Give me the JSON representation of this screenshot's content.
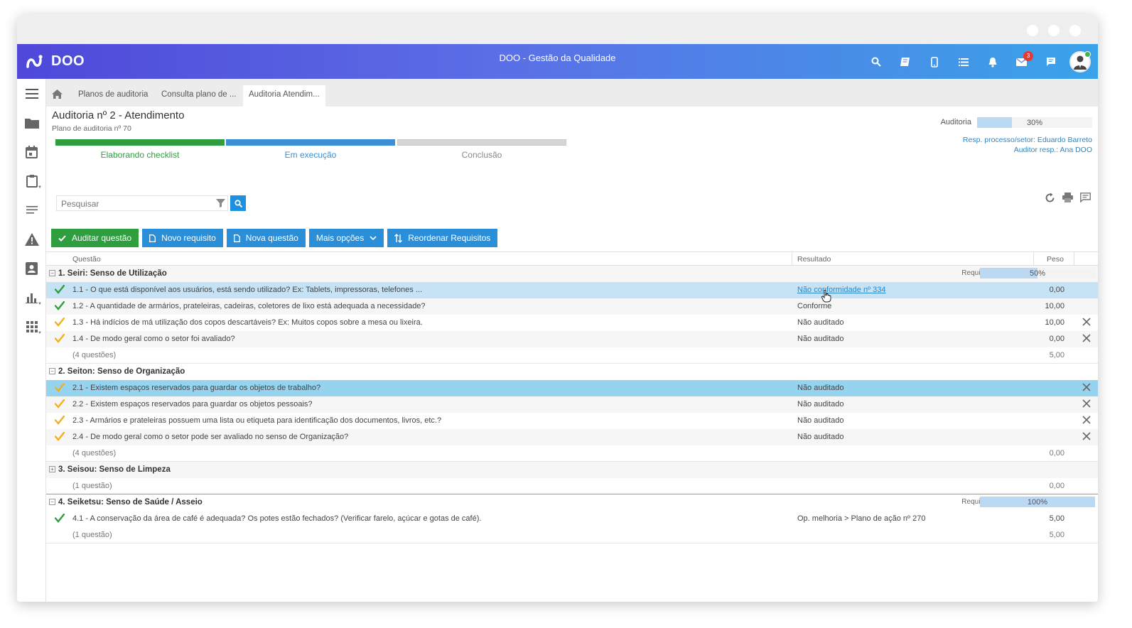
{
  "app": {
    "logo_text": "DOO",
    "title": "DOO - Gestão da Qualidade",
    "notification_count": "3"
  },
  "topbar_icons": [
    "search-icon",
    "book-icon",
    "mobile-icon",
    "list-icon",
    "bell-icon",
    "mail-icon",
    "chat-icon"
  ],
  "sidebar_icons": [
    "menu-icon",
    "folder-icon",
    "calendar-icon",
    "clipboard-icon",
    "lines-icon",
    "warning-icon",
    "contact-icon",
    "chart-icon",
    "apps-icon"
  ],
  "breadcrumb": {
    "tabs": [
      "Planos de auditoria",
      "Consulta plano de ...",
      "Auditoria Atendim..."
    ]
  },
  "header": {
    "title": "Auditoria nº 2 - Atendimento",
    "subtitle": "Plano de auditoria nº 70",
    "steps": [
      {
        "label": "Elaborando checklist",
        "color": "#2e9e3f",
        "text_color": "#2e9e3f"
      },
      {
        "label": "Em execução",
        "color": "#3b8fd4",
        "text_color": "#3b8fd4"
      },
      {
        "label": "Conclusão",
        "color": "#d6d6d6",
        "text_color": "#888888"
      }
    ],
    "audit_label": "Auditoria",
    "audit_progress": 0.3,
    "audit_progress_text": "30%",
    "resp_process": "Resp. processo/setor: Eduardo Barreto",
    "auditor": "Auditor resp.: Ana DOO"
  },
  "search": {
    "placeholder": "Pesquisar"
  },
  "toolbar": {
    "audit": "Auditar questão",
    "new_req": "Novo requisito",
    "new_question": "Nova questão",
    "more": "Mais opções",
    "reorder": "Reordenar Requisitos"
  },
  "grid": {
    "columns": {
      "question": "Questão",
      "result": "Resultado",
      "weight": "Peso"
    },
    "groups": [
      {
        "title": "1. Seiri: Senso de Utilização",
        "expanded": true,
        "req_label": "Requisito",
        "req_progress": 0.5,
        "req_text": "50%",
        "rows": [
          {
            "q": "1.1 - O que está disponível aos usuários, está sendo utilizado? Ex: Tablets, impressoras, telefones ...",
            "result": "Não conformidade nº 334",
            "weight": "0,00",
            "check": "green",
            "link": true,
            "x": false
          },
          {
            "q": "1.2 - A quantidade de armários, prateleiras, cadeiras, coletores de lixo está adequada a necessidade?",
            "result": "Conforme",
            "weight": "10,00",
            "check": "green",
            "link": false,
            "x": false
          },
          {
            "q": "1.3 - Há indícios de má utilização dos copos descartáveis? Ex: Muitos copos sobre a mesa ou lixeira.",
            "result": "Não auditado",
            "weight": "10,00",
            "check": "yellow",
            "link": false,
            "x": true
          },
          {
            "q": "1.4 - De modo geral como o setor foi avaliado?",
            "result": "Não auditado",
            "weight": "0,00",
            "check": "yellow",
            "link": false,
            "x": true
          }
        ],
        "summary": "(4 questões)",
        "summary_weight": "5,00"
      },
      {
        "title": "2. Seiton: Senso de Organização",
        "expanded": true,
        "rows": [
          {
            "q": "2.1 - Existem espaços reservados para guardar os objetos de trabalho?",
            "result": "Não auditado",
            "weight": "",
            "check": "yellow",
            "link": false,
            "x": true
          },
          {
            "q": "2.2 - Existem espaços reservados para guardar os objetos pessoais?",
            "result": "Não auditado",
            "weight": "",
            "check": "yellow",
            "link": false,
            "x": true
          },
          {
            "q": "2.3 - Armários e prateleiras possuem uma lista ou etiqueta para identificação dos documentos, livros, etc.?",
            "result": "Não auditado",
            "weight": "",
            "check": "yellow",
            "link": false,
            "x": true
          },
          {
            "q": "2.4 - De modo geral como o setor pode ser avaliado no senso de Organização?",
            "result": "Não auditado",
            "weight": "",
            "check": "yellow",
            "link": false,
            "x": true
          }
        ],
        "summary": "(4 questões)",
        "summary_weight": "0,00"
      },
      {
        "title": "3. Seisou: Senso de Limpeza",
        "expanded": false,
        "rows": [],
        "summary": "(1 questão)",
        "summary_weight": "0,00"
      },
      {
        "title": "4. Seiketsu: Senso de Saúde / Asseio",
        "expanded": true,
        "req_label": "Requisito",
        "req_progress": 1.0,
        "req_text": "100%",
        "rows": [
          {
            "q": "4.1 - A conservação da área de café é adequada? Os potes estão fechados? (Verificar farelo, açúcar e gotas de café).",
            "result": "Op. melhoria > Plano de ação nº 270",
            "weight": "5,00",
            "check": "green",
            "link": false,
            "x": false
          }
        ],
        "summary": "(1 questão)",
        "summary_weight": "5,00"
      }
    ]
  }
}
